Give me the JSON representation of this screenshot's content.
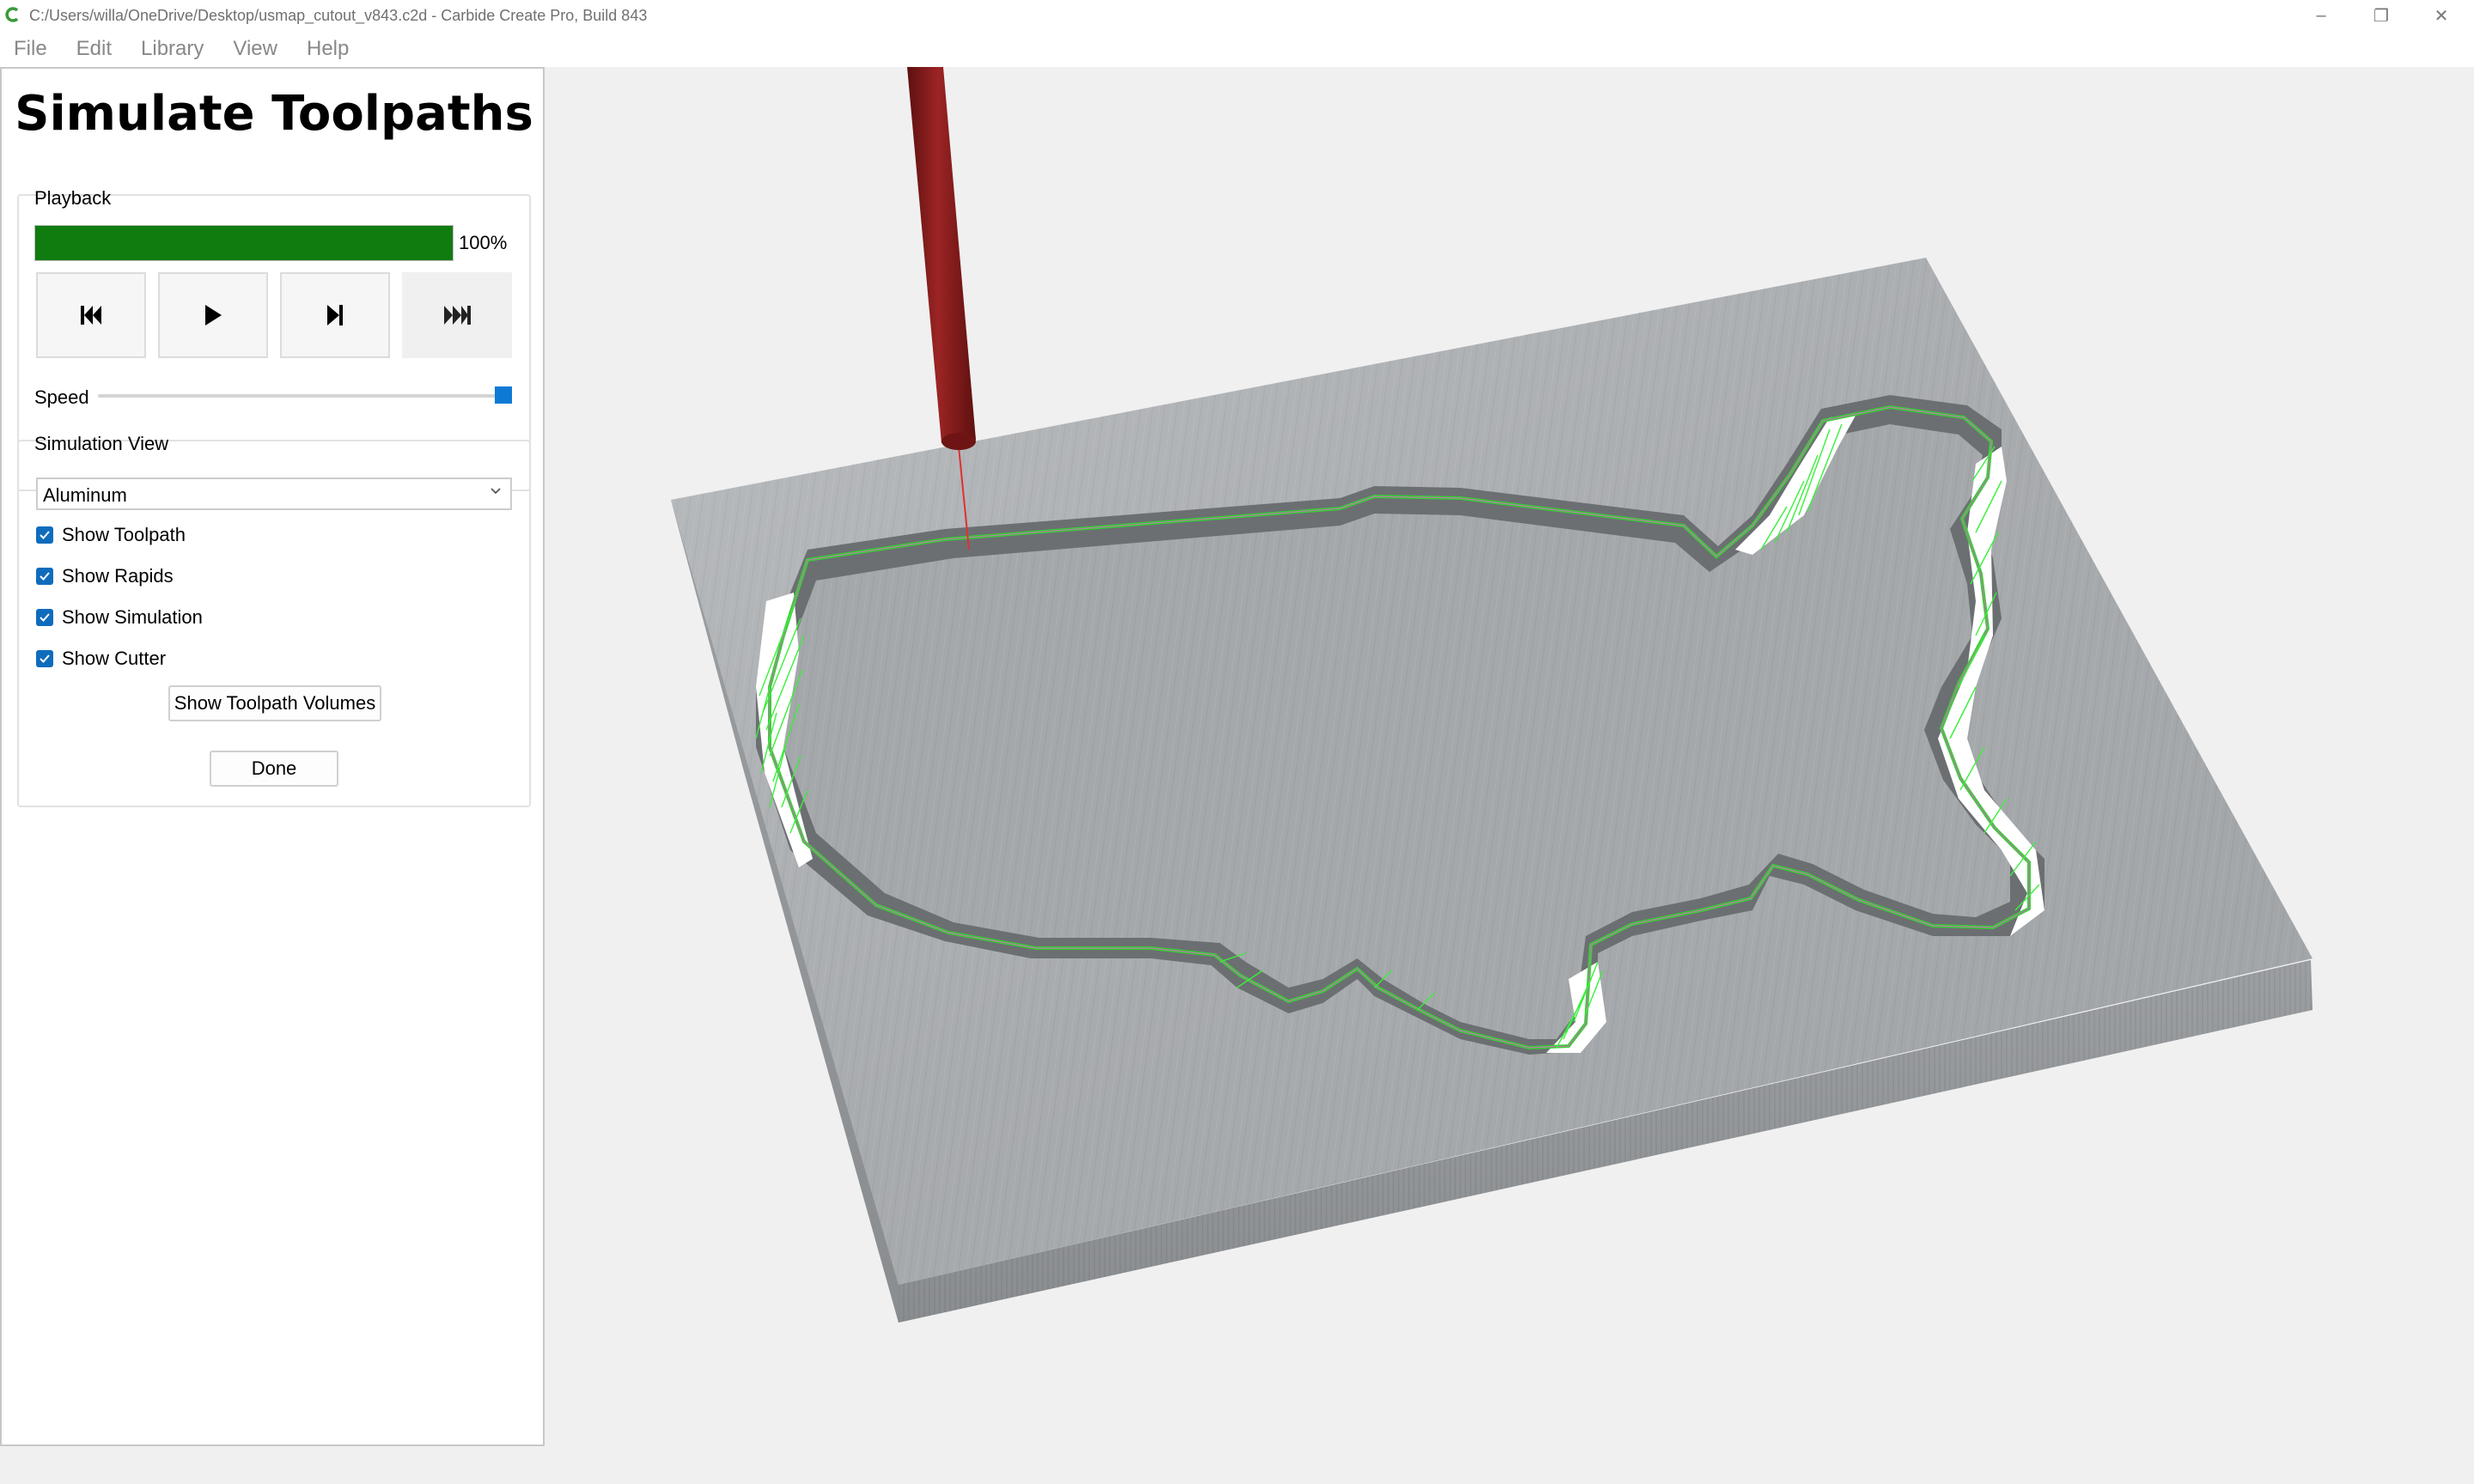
{
  "window": {
    "title": "C:/Users/willa/OneDrive/Desktop/usmap_cutout_v843.c2d - Carbide Create Pro, Build 843",
    "controls": {
      "minimize": "–",
      "restore": "❐",
      "close": "✕"
    }
  },
  "menu": {
    "items": [
      "File",
      "Edit",
      "Library",
      "View",
      "Help"
    ]
  },
  "panel": {
    "title": "Simulate Toolpaths",
    "playback": {
      "label": "Playback",
      "progress_percent": 100,
      "progress_text": "100%",
      "buttons": [
        "skip-to-start-icon",
        "play-icon",
        "step-forward-icon",
        "skip-to-end-icon"
      ],
      "progress_color": "#107c10"
    },
    "speed": {
      "label": "Speed",
      "value_fraction": 1.0
    },
    "simulation_view": {
      "label": "Simulation View",
      "material": "Aluminum",
      "options": [
        {
          "label": "Show Toolpath",
          "checked": true
        },
        {
          "label": "Show Rapids",
          "checked": true
        },
        {
          "label": "Show Simulation",
          "checked": true
        },
        {
          "label": "Show Cutter",
          "checked": true
        }
      ],
      "volumes_button": "Show Toolpath Volumes"
    },
    "done_button": "Done"
  },
  "colors": {
    "accent": "#0f6cbd",
    "progress": "#107c10",
    "cutter": "#8b1c1c",
    "toolpath": "#33ee33",
    "stock": "#a9adb0"
  }
}
